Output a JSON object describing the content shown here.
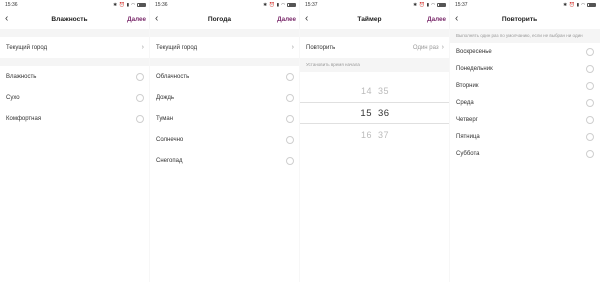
{
  "screens": [
    {
      "time": "15:36",
      "title": "Влажность",
      "next": "Далее",
      "current_city": "Текущий город",
      "options": [
        "Влажность",
        "Сухо",
        "Комфортная"
      ]
    },
    {
      "time": "15:36",
      "title": "Погода",
      "next": "Далее",
      "current_city": "Текущий город",
      "options": [
        "Облачность",
        "Дождь",
        "Туман",
        "Солнечно",
        "Снегопад"
      ]
    },
    {
      "time": "15:37",
      "title": "Таймер",
      "next": "Далее",
      "repeat_label": "Повторить",
      "repeat_value": "Один раз",
      "set_start_time": "Установить время начала",
      "picker": {
        "above": {
          "h": "14",
          "m": "35"
        },
        "selected": {
          "h": "15",
          "m": "36"
        },
        "below": {
          "h": "16",
          "m": "37"
        }
      }
    },
    {
      "time": "15:37",
      "title": "Повторить",
      "hint": "Выполнять один раз по умолчанию, если не выбран ни один",
      "days": [
        "Воскресенье",
        "Понедельник",
        "Вторник",
        "Среда",
        "Четверг",
        "Пятница",
        "Суббота"
      ]
    }
  ],
  "icons": {
    "back": "back-arrow-icon",
    "chevron": "chevron-right-icon",
    "radio": "radio-unselected-icon"
  },
  "colors": {
    "accent": "#7a2a6b",
    "separator": "#f5f5f5"
  }
}
